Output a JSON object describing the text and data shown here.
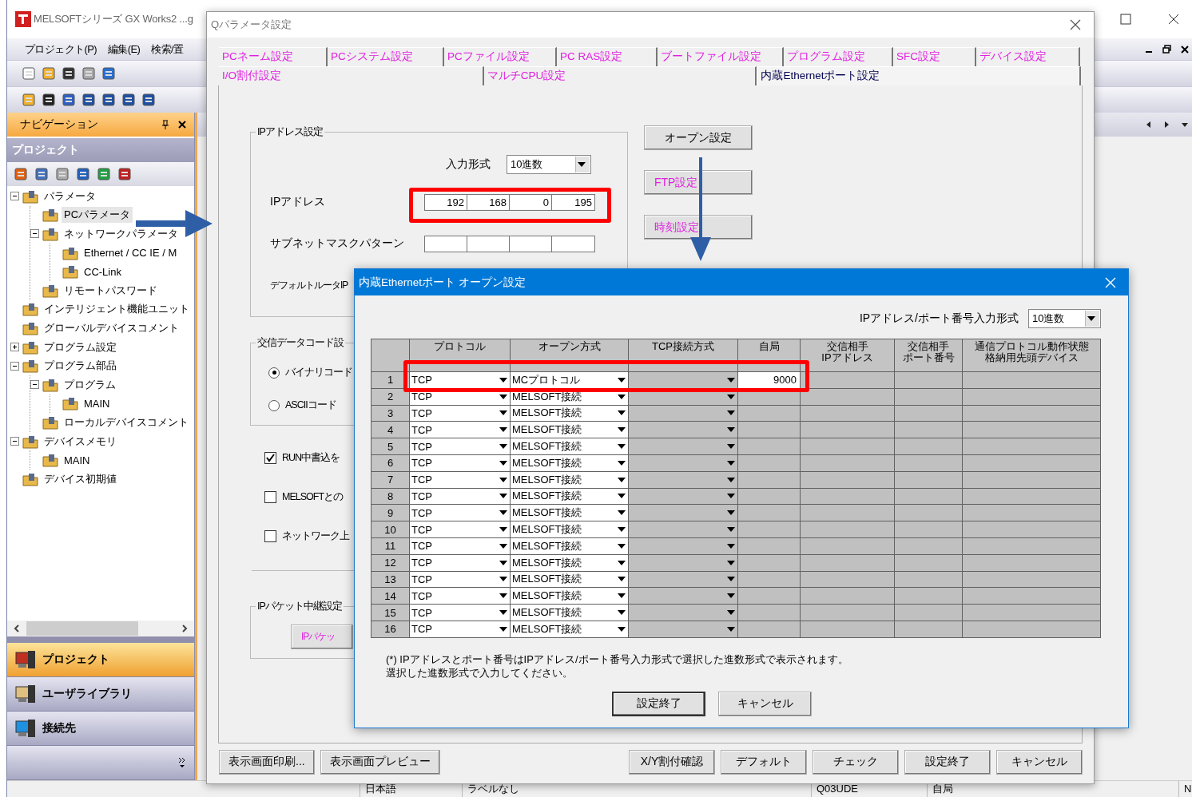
{
  "app": {
    "title": "MELSOFTシリーズ GX Works2 ...g",
    "menu": [
      {
        "label": "プロジェクト(P)"
      },
      {
        "label": "編集(E)"
      },
      {
        "label": "検索/置"
      }
    ]
  },
  "navigation": {
    "title": "ナビゲーション",
    "section": "プロジェクト",
    "tree": [
      {
        "label": "パラメータ",
        "expanded": true,
        "selected": false,
        "children": [
          {
            "label": "PCパラメータ",
            "selected": true
          },
          {
            "label": "ネットワークパラメータ",
            "expanded": true,
            "selected": false,
            "children": [
              {
                "label": "Ethernet / CC IE / M",
                "selected": false
              },
              {
                "label": "CC-Link",
                "selected": false
              }
            ]
          },
          {
            "label": "リモートパスワード",
            "selected": false
          }
        ]
      },
      {
        "label": "インテリジェント機能ユニット",
        "selected": false
      },
      {
        "label": "グローバルデバイスコメント",
        "selected": false
      },
      {
        "label": "プログラム設定",
        "expanded": false,
        "selected": false
      },
      {
        "label": "プログラム部品",
        "expanded": true,
        "selected": false,
        "children": [
          {
            "label": "プログラム",
            "expanded": true,
            "selected": false,
            "children": [
              {
                "label": "MAIN",
                "selected": false
              }
            ]
          },
          {
            "label": "ローカルデバイスコメント",
            "selected": false
          }
        ]
      },
      {
        "label": "デバイスメモリ",
        "expanded": true,
        "selected": false,
        "children": [
          {
            "label": "MAIN",
            "selected": false
          }
        ]
      },
      {
        "label": "デバイス初期値",
        "selected": false
      }
    ],
    "tabs": [
      {
        "label": "プロジェクト",
        "selected": true
      },
      {
        "label": "ユーザライブラリ",
        "selected": false
      },
      {
        "label": "接続先",
        "selected": false
      }
    ]
  },
  "parameter_dialog": {
    "title": "Qパラメータ設定",
    "tab_rows": [
      {
        "tabs": [
          {
            "label": "PCネーム設定",
            "selected": false
          },
          {
            "label": "PCシステム設定",
            "selected": false
          },
          {
            "label": "PCファイル設定",
            "selected": false
          },
          {
            "label": "PC RAS設定",
            "selected": false
          },
          {
            "label": "ブートファイル設定",
            "selected": false
          },
          {
            "label": "プログラム設定",
            "selected": false
          },
          {
            "label": "SFC設定",
            "selected": false
          },
          {
            "label": "デバイス設定",
            "selected": false
          }
        ]
      },
      {
        "tabs": [
          {
            "label": "I/O割付設定",
            "selected": false
          },
          {
            "label": "マルチCPU設定",
            "selected": false
          },
          {
            "label": "内蔵Ethernetポート設定",
            "selected": true
          }
        ]
      }
    ],
    "ip_settings": {
      "label": "IPアドレス設定",
      "input_format_label": "入力形式",
      "input_format": "10進数",
      "ip_label": "IPアドレス",
      "ip_octets": [
        "192",
        "168",
        "0",
        "195"
      ],
      "subnet_label": "サブネットマスクパターン",
      "router_label": "デフォルトルータIP"
    },
    "side_buttons": [
      {
        "label": "オープン設定",
        "highlighted": false
      },
      {
        "label": "FTP設定",
        "highlighted": true
      },
      {
        "label": "時刻設定",
        "highlighted": true
      }
    ],
    "code_settings": {
      "label": "交信データコード設",
      "options": [
        {
          "label": "バイナリコード",
          "selected": true
        },
        {
          "label": "ASCIIコード",
          "selected": false
        }
      ]
    },
    "checkboxes": [
      {
        "label": "RUN中書込を",
        "checked": true
      },
      {
        "label": "MELSOFTとの",
        "checked": false
      },
      {
        "label": "ネットワーク上",
        "checked": false
      }
    ],
    "relay": {
      "label": "IPパケット中継設定",
      "button": "IPパケッ",
      "highlighted": true
    },
    "buttons_left": [
      "表示画面印刷...",
      "表示画面プレビュー"
    ],
    "buttons_right": [
      "X/Y割付確認",
      "デフォルト",
      "チェック",
      "設定終了",
      "キャンセル"
    ]
  },
  "open_dialog": {
    "title": "内蔵Ethernetポート オープン設定",
    "format_label": "IPアドレス/ポート番号入力形式",
    "format": "10進数",
    "columns": [
      {
        "lines": [
          "プロトコル"
        ]
      },
      {
        "lines": [
          "オープン方式"
        ]
      },
      {
        "lines": [
          "TCP接続方式"
        ]
      },
      {
        "lines": [
          "自局"
        ]
      },
      {
        "lines": [
          "交信相手",
          "IPアドレス"
        ]
      },
      {
        "lines": [
          "交信相手",
          "ポート番号"
        ]
      },
      {
        "lines": [
          "通信プロトコル動作状態",
          "格納用先頭デバイス"
        ]
      }
    ],
    "rows": [
      {
        "no": "1",
        "protocol": "TCP",
        "open_method": "MCプロトコル",
        "port": "9000",
        "port_disabled": false
      },
      {
        "no": "2",
        "protocol": "TCP",
        "open_method": "MELSOFT接続",
        "port_disabled": true
      },
      {
        "no": "3",
        "protocol": "TCP",
        "open_method": "MELSOFT接続",
        "port_disabled": true
      },
      {
        "no": "4",
        "protocol": "TCP",
        "open_method": "MELSOFT接続",
        "port_disabled": true
      },
      {
        "no": "5",
        "protocol": "TCP",
        "open_method": "MELSOFT接続",
        "port_disabled": true
      },
      {
        "no": "6",
        "protocol": "TCP",
        "open_method": "MELSOFT接続",
        "port_disabled": true
      },
      {
        "no": "7",
        "protocol": "TCP",
        "open_method": "MELSOFT接続",
        "port_disabled": true
      },
      {
        "no": "8",
        "protocol": "TCP",
        "open_method": "MELSOFT接続",
        "port_disabled": true
      },
      {
        "no": "9",
        "protocol": "TCP",
        "open_method": "MELSOFT接続",
        "port_disabled": true
      },
      {
        "no": "10",
        "protocol": "TCP",
        "open_method": "MELSOFT接続",
        "port_disabled": true
      },
      {
        "no": "11",
        "protocol": "TCP",
        "open_method": "MELSOFT接続",
        "port_disabled": true
      },
      {
        "no": "12",
        "protocol": "TCP",
        "open_method": "MELSOFT接続",
        "port_disabled": true
      },
      {
        "no": "13",
        "protocol": "TCP",
        "open_method": "MELSOFT接続",
        "port_disabled": true
      },
      {
        "no": "14",
        "protocol": "TCP",
        "open_method": "MELSOFT接続",
        "port_disabled": true
      },
      {
        "no": "15",
        "protocol": "TCP",
        "open_method": "MELSOFT接続",
        "port_disabled": true
      },
      {
        "no": "16",
        "protocol": "TCP",
        "open_method": "MELSOFT接続",
        "port_disabled": true
      }
    ],
    "note": [
      "(*) IPアドレスとポート番号はIPアドレス/ポート番号入力形式で選択した進数形式で表示されます。",
      "選択した進数形式で入力してください。"
    ],
    "buttons": [
      "設定終了",
      "キャンセル"
    ]
  },
  "status_bar": [
    "日本語",
    "ラベルなし",
    "Q03UDE",
    "自局",
    "N"
  ]
}
